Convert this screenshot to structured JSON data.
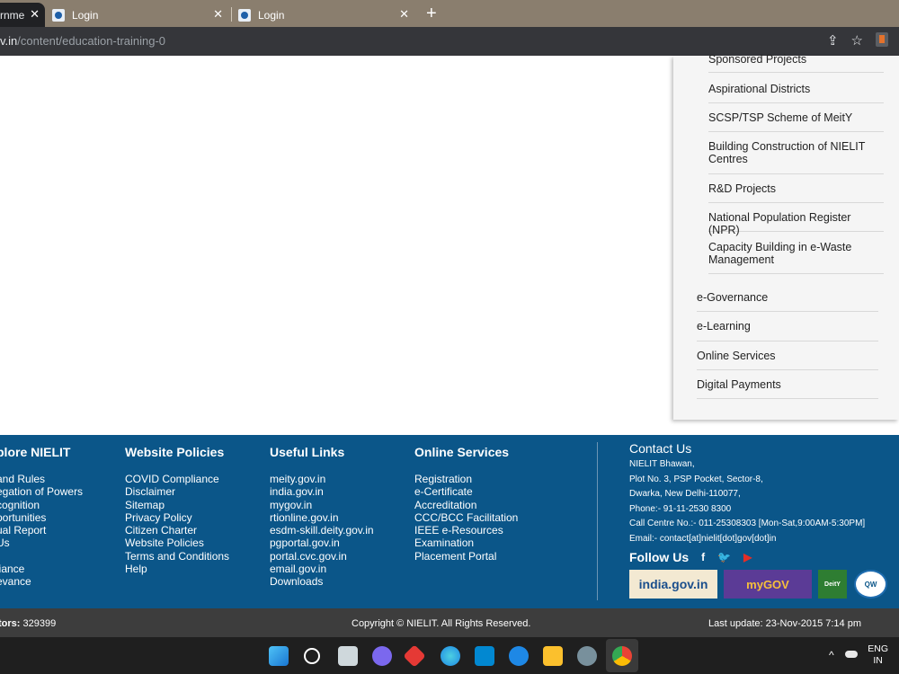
{
  "browser": {
    "tabs": [
      {
        "label": "rnme",
        "close": "✕"
      },
      {
        "label": "Login",
        "close": "✕"
      },
      {
        "label": "Login",
        "close": "✕"
      }
    ],
    "new_tab": "+",
    "url_host": "v.in",
    "url_path": "/content/education-training-0"
  },
  "sidebar": {
    "sub_items": [
      "Sponsored Projects",
      "Aspirational Districts",
      "SCSP/TSP Scheme of MeitY",
      "Building Construction of NIELIT Centres",
      "R&D Projects",
      "National Population Register (NPR)",
      "Capacity Building in e-Waste Management"
    ],
    "main_items": [
      "e-Governance",
      "e-Learning",
      "Online Services",
      "Digital Payments"
    ]
  },
  "footer": {
    "explore": {
      "title": "plore NIELIT",
      "items": [
        "and Rules",
        "egation of Powers",
        "cognition",
        "portunities",
        "ual Report",
        "Us",
        "",
        "liance",
        "evance"
      ]
    },
    "policies": {
      "title": "Website Policies",
      "items": [
        "COVID Compliance",
        "Disclaimer",
        "Sitemap",
        "Privacy Policy",
        "Citizen Charter",
        "Website Policies",
        "Terms and Conditions",
        "Help"
      ]
    },
    "useful": {
      "title": "Useful Links",
      "items": [
        "meity.gov.in",
        "india.gov.in",
        "mygov.in",
        "rtionline.gov.in",
        "esdm-skill.deity.gov.in",
        "pgportal.gov.in",
        "portal.cvc.gov.in",
        "email.gov.in",
        "Downloads"
      ]
    },
    "online": {
      "title": "Online Services",
      "items": [
        "Registration",
        "e-Certificate",
        "Accreditation",
        "CCC/BCC Facilitation",
        "IEEE e-Resources",
        "Examination",
        "Placement Portal"
      ]
    },
    "contact": {
      "title": "Contact Us",
      "lines": [
        "NIELIT Bhawan,",
        "Plot No. 3, PSP Pocket, Sector-8,",
        "Dwarka, New Delhi-110077,",
        "Phone:- 91-11-2530 8300",
        "Call Centre No.:- 011-25308303 [Mon-Sat,9:00AM-5:30PM]",
        "Email:- contact[at]nielit[dot]gov[dot]in"
      ]
    },
    "follow": {
      "title": "Follow Us",
      "facebook": "f",
      "twitter": "🐦",
      "youtube": "▶"
    },
    "logos": {
      "india": "india.gov.in",
      "mygov": "myGOV",
      "deity": "DeitY",
      "seal": "QW"
    }
  },
  "bottom": {
    "visitors_label": "tors:",
    "visitors_count": "329399",
    "copyright": "Copyright © NIELIT. All Rights Reserved.",
    "last_update": "Last update: 23-Nov-2015 7:14 pm"
  },
  "taskbar": {
    "chevron": "^",
    "lang": "ENG",
    "region": "IN"
  }
}
